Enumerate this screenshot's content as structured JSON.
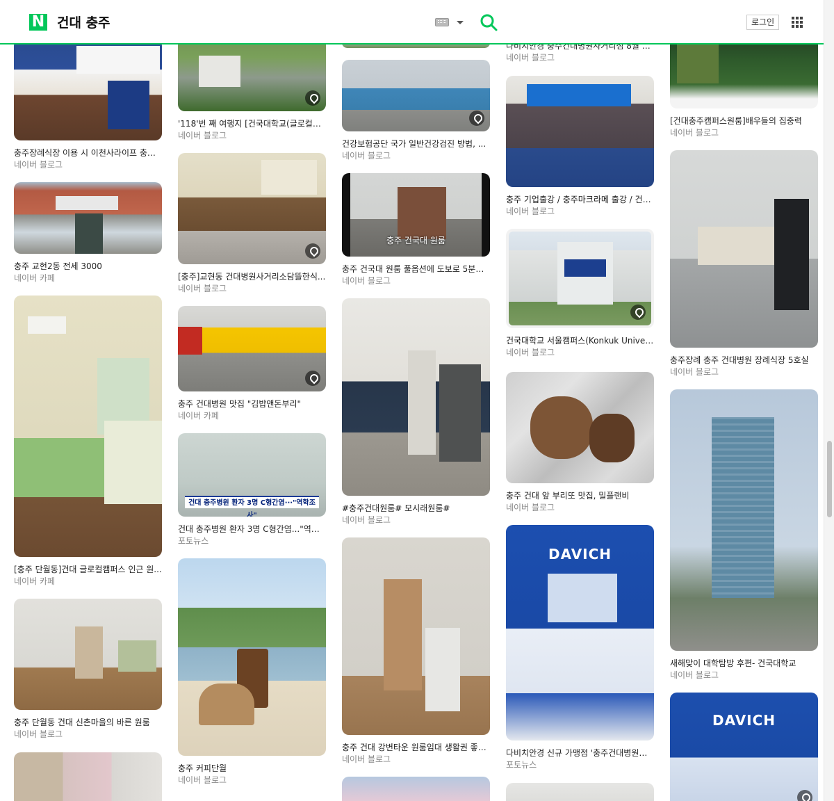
{
  "header": {
    "logo": "N",
    "query": "건대 충주",
    "login_label": "로그인"
  },
  "icons": [
    "keyboard-icon",
    "chevron-down-icon",
    "search-icon",
    "apps-grid-icon",
    "location-pin-icon"
  ],
  "colors": {
    "brand": "#03c75a",
    "text": "#222222",
    "source": "#888888"
  },
  "columns": [
    [
      {
        "title": "충주장례식장 이용 시 이천사라이프 충주...",
        "source": "네이버 블로그"
      },
      {
        "title": "충주 교현2동 전세 3000",
        "source": "네이버 카페"
      },
      {
        "title": "[충주 단월동]건대 글로컬캠퍼스 인근 원...",
        "source": "네이버 카페"
      },
      {
        "title": "충주 단월동 건대 신촌마을의 바른 원룸",
        "source": "네이버 블로그"
      },
      {
        "title": "",
        "source": ""
      }
    ],
    [
      {
        "title": "'118'번 째 여행지 [건국대학교(글로컬캠...",
        "source": "네이버 블로그"
      },
      {
        "title": "[충주]교현동 건대병원사거리소담뜰한식...",
        "source": "네이버 블로그"
      },
      {
        "title": "충주 건대병원 맛집 \"김밥앤돈부리\"",
        "source": "네이버 카페"
      },
      {
        "title": "건대 충주병원 환자 3명 C형간염...\"역학...",
        "source": "포토뉴스"
      },
      {
        "title": "충주 커피단월",
        "source": "네이버 블로그"
      }
    ],
    [
      {
        "title": "",
        "source": ""
      },
      {
        "title": "건강보험공단 국가 일반건강검진 방법, ...",
        "source": "네이버 블로그"
      },
      {
        "title": "충주 건국대 원룸 풀옵션에 도보로 5분거...",
        "source": "네이버 블로그"
      },
      {
        "title": "#충주건대원룸# 모시래원룸#",
        "source": "네이버 블로그"
      },
      {
        "title": "충주 건대 강변타운 원룸임대 생활권 좋아...",
        "source": "네이버 블로그"
      },
      {
        "title": "",
        "source": ""
      }
    ],
    [
      {
        "title": "다비치안경 충주건대병원사거리점 8월 2...",
        "source": "네이버 블로그"
      },
      {
        "title": "충주 기업출강 / 충주마크라메 출강 / 건대...",
        "source": "네이버 블로그"
      },
      {
        "title": "건국대학교 서울캠퍼스(Konkuk Univer...",
        "source": "네이버 블로그"
      },
      {
        "title": "충주 건대 앞 부리또 맛집, 밀플랜비",
        "source": "네이버 블로그"
      },
      {
        "title": "다비치안경 신규 가맹점 '충주건대병원사...",
        "source": "포토뉴스"
      },
      {
        "title": "",
        "source": ""
      }
    ],
    [
      {
        "title": "[건대충주캠퍼스원룸]배우들의 집중력",
        "source": "네이버 블로그"
      },
      {
        "title": "충주장례 충주 건대병원 장례식장 5호실",
        "source": "네이버 블로그"
      },
      {
        "title": "새해맞이 대학탐방 후편- 건국대학교",
        "source": "네이버 블로그"
      },
      {
        "title": "",
        "source": ""
      }
    ]
  ],
  "image_text": {
    "wonroom_overlay": "충주 건국대 원룸",
    "news_caption": "건대 충주병원 환자 3명 C형간염···\"역학조사\"",
    "davich_brand": "DAVICH",
    "davich_brand_2": "DAVICH"
  }
}
